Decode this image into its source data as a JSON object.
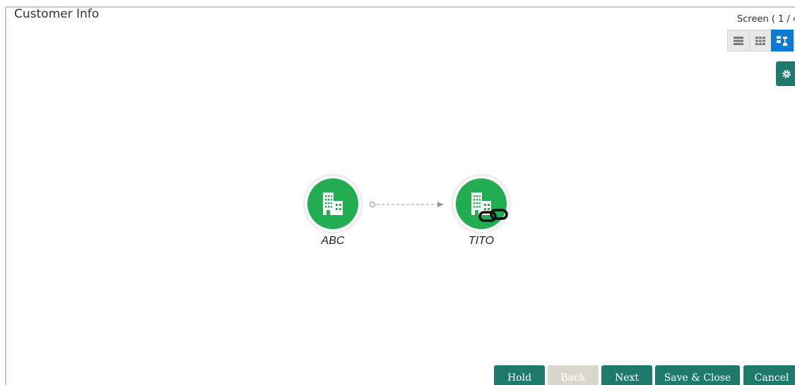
{
  "header": {
    "title": "Customer Info",
    "screen_indicator": "Screen ( 1 / 4"
  },
  "view_toggle": {
    "icons": [
      "list-view-icon",
      "grid-view-icon",
      "hierarchy-view-icon"
    ],
    "active": "hierarchy-view-icon",
    "active_color": "#0a7bd6"
  },
  "settings": {
    "icon": "gear-icon",
    "color": "#1f7a6e"
  },
  "diagram": {
    "nodes": [
      {
        "label": "ABC",
        "icon": "building-icon",
        "linked": false
      },
      {
        "label": "TITO",
        "icon": "building-icon",
        "linked": true
      }
    ],
    "node_color": "#23ad53"
  },
  "footer": {
    "buttons": [
      {
        "label": "Hold",
        "enabled": true
      },
      {
        "label": "Back",
        "enabled": false
      },
      {
        "label": "Next",
        "enabled": true
      },
      {
        "label": "Save & Close",
        "enabled": true
      },
      {
        "label": "Cancel",
        "enabled": true
      }
    ],
    "button_color": "#1f7a6e",
    "disabled_color": "#d9d6cc"
  }
}
